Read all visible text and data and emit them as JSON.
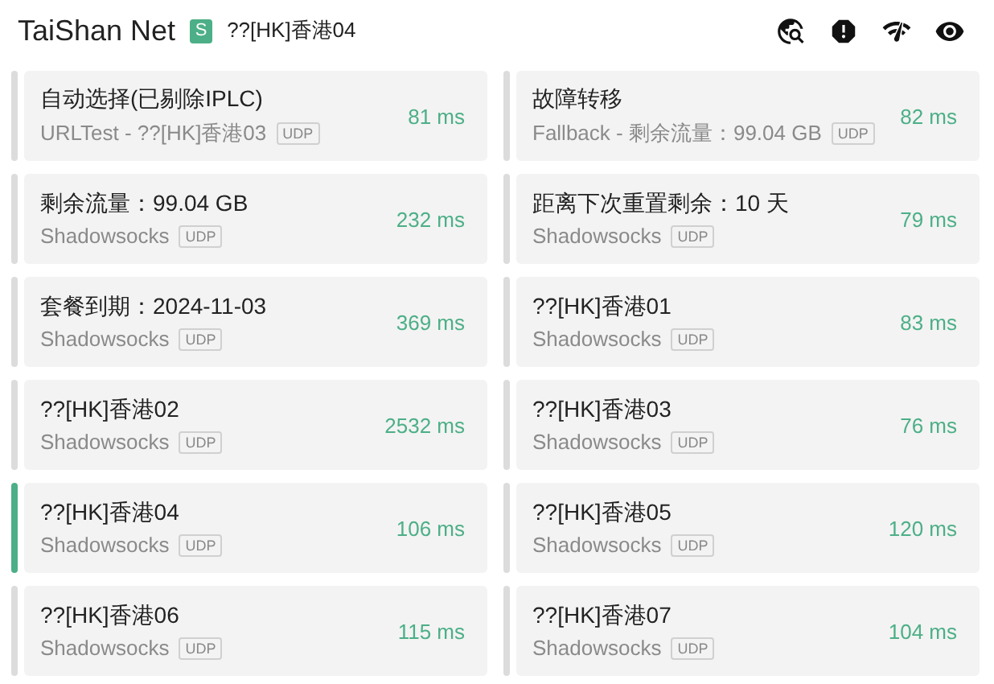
{
  "header": {
    "title": "TaiShan Net",
    "badge": "S",
    "current": "??[HK]香港04"
  },
  "proxies": [
    {
      "name": "自动选择(已剔除IPLC)",
      "type": "URLTest - ??[HK]香港03",
      "tag": "UDP",
      "delay": "81 ms",
      "selected": false
    },
    {
      "name": "故障转移",
      "type": "Fallback - 剩余流量：99.04 GB",
      "tag": "UDP",
      "delay": "82 ms",
      "selected": false
    },
    {
      "name": "剩余流量：99.04 GB",
      "type": "Shadowsocks",
      "tag": "UDP",
      "delay": "232 ms",
      "selected": false
    },
    {
      "name": "距离下次重置剩余：10 天",
      "type": "Shadowsocks",
      "tag": "UDP",
      "delay": "79 ms",
      "selected": false
    },
    {
      "name": "套餐到期：2024-11-03",
      "type": "Shadowsocks",
      "tag": "UDP",
      "delay": "369 ms",
      "selected": false
    },
    {
      "name": "??[HK]香港01",
      "type": "Shadowsocks",
      "tag": "UDP",
      "delay": "83 ms",
      "selected": false
    },
    {
      "name": "??[HK]香港02",
      "type": "Shadowsocks",
      "tag": "UDP",
      "delay": "2532 ms",
      "selected": false
    },
    {
      "name": "??[HK]香港03",
      "type": "Shadowsocks",
      "tag": "UDP",
      "delay": "76 ms",
      "selected": false
    },
    {
      "name": "??[HK]香港04",
      "type": "Shadowsocks",
      "tag": "UDP",
      "delay": "106 ms",
      "selected": true
    },
    {
      "name": "??[HK]香港05",
      "type": "Shadowsocks",
      "tag": "UDP",
      "delay": "120 ms",
      "selected": false
    },
    {
      "name": "??[HK]香港06",
      "type": "Shadowsocks",
      "tag": "UDP",
      "delay": "115 ms",
      "selected": false
    },
    {
      "name": "??[HK]香港07",
      "type": "Shadowsocks",
      "tag": "UDP",
      "delay": "104 ms",
      "selected": false
    }
  ]
}
